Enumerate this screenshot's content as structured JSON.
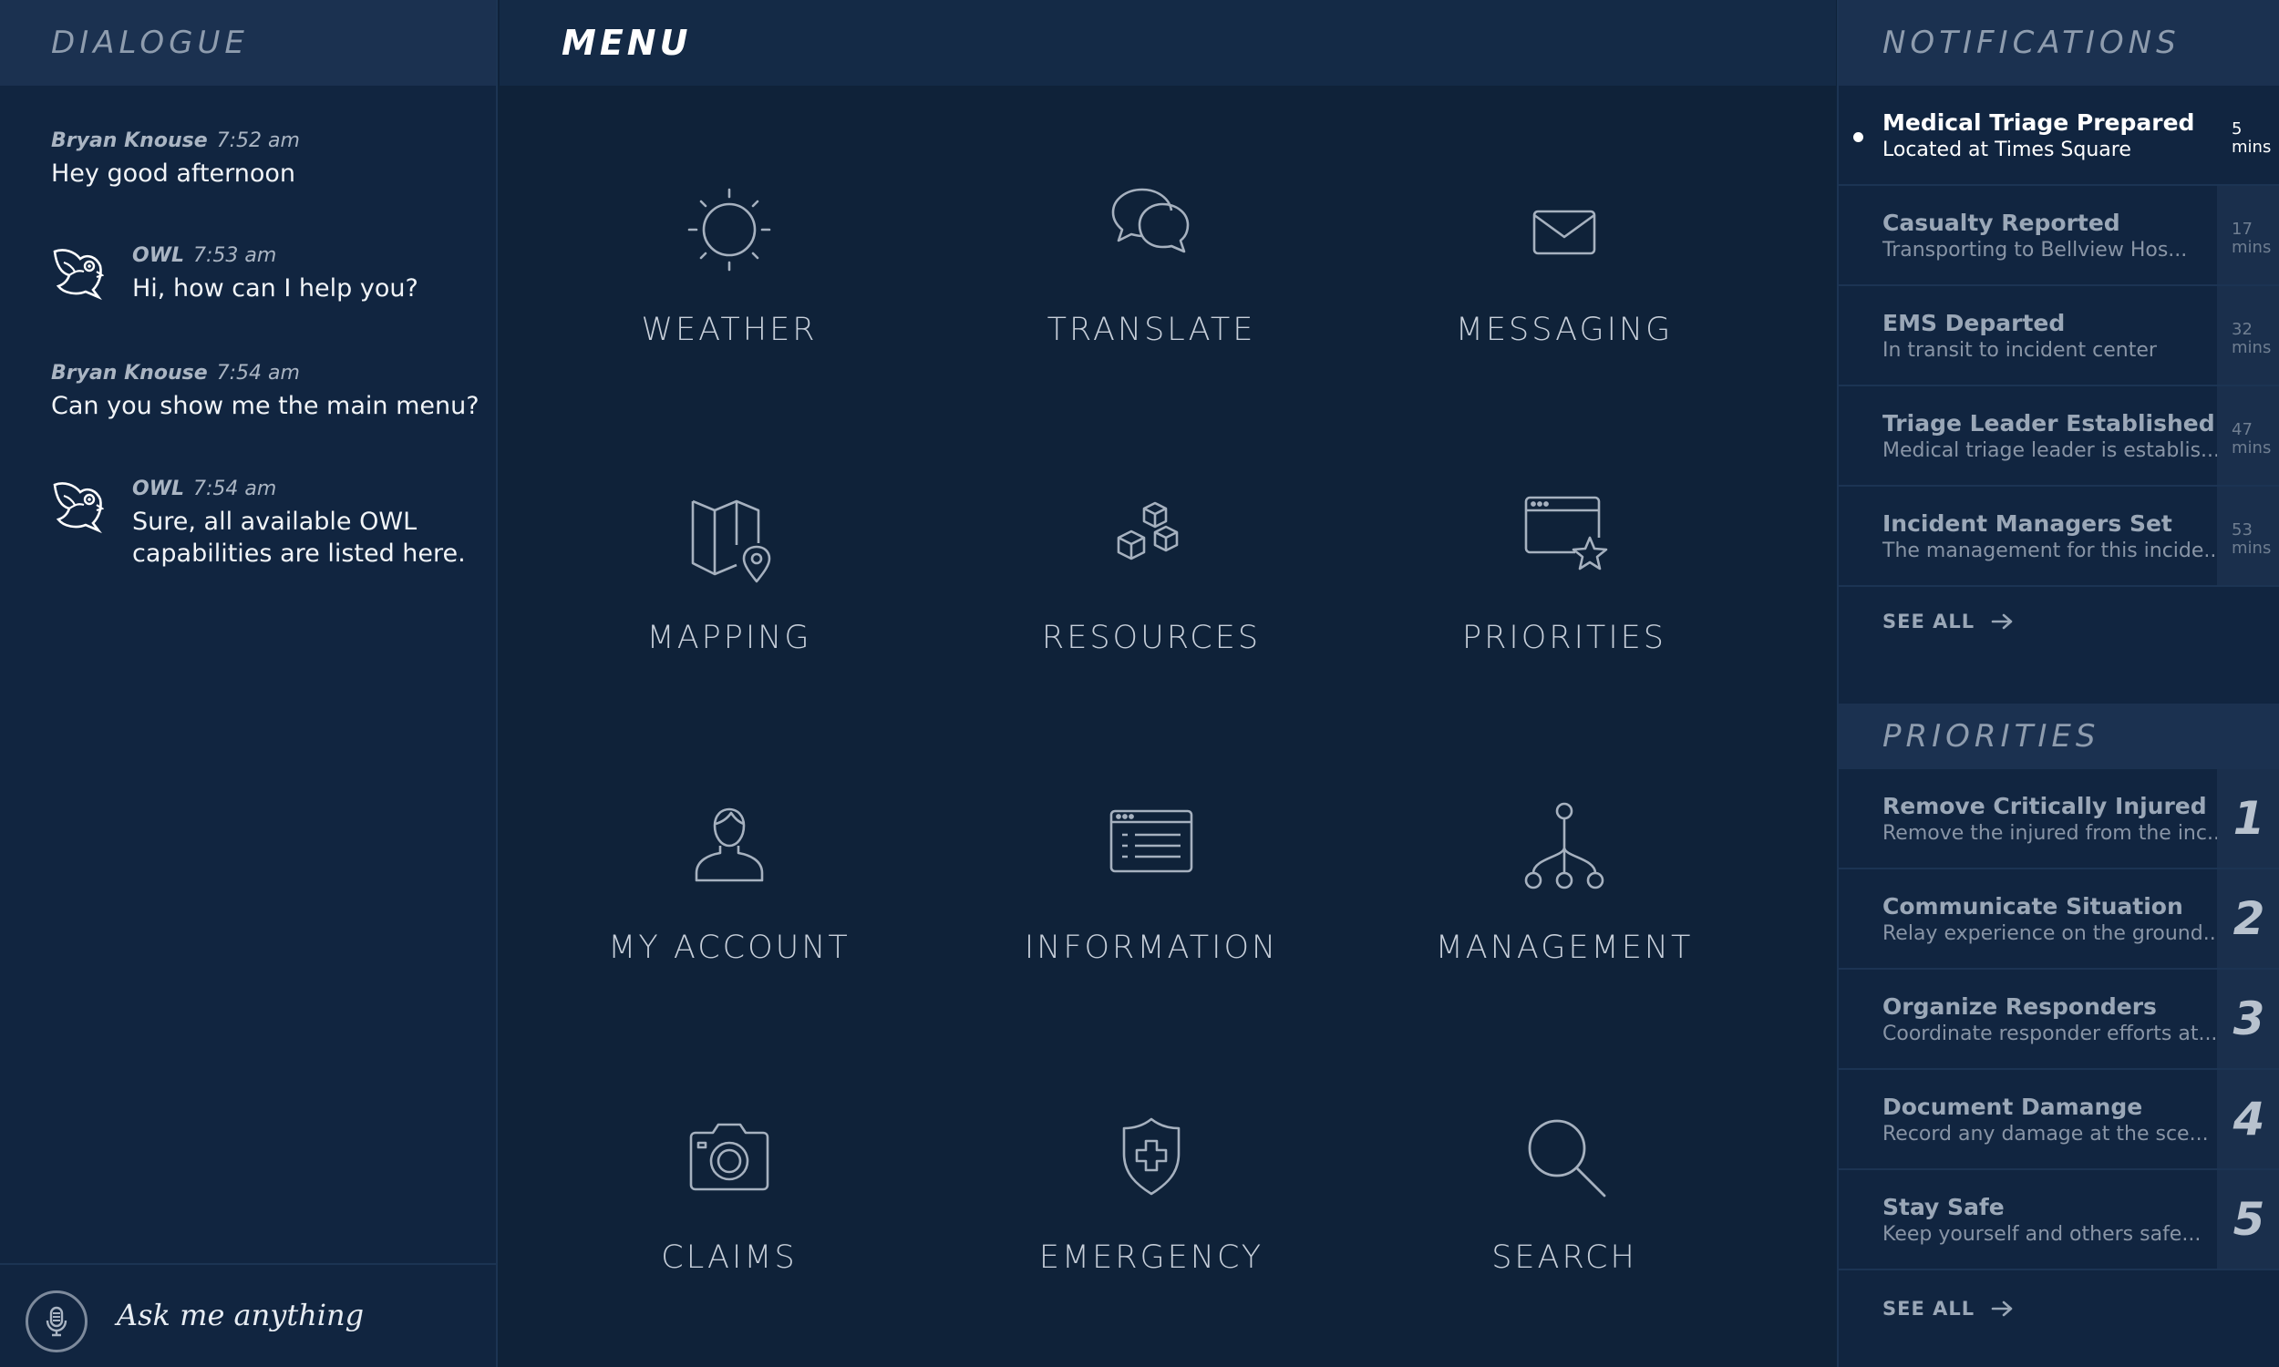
{
  "dialogue": {
    "title": "DIALOGUE",
    "messages": [
      {
        "author": "Bryan Knouse",
        "time": "7:52 am",
        "text": "Hey good afternoon"
      },
      {
        "author": "OWL",
        "time": "7:53 am",
        "text": "Hi, how can I help you?"
      },
      {
        "author": "Bryan Knouse",
        "time": "7:54 am",
        "text": "Can you show me the main menu?"
      },
      {
        "author": "OWL",
        "time": "7:54 am",
        "text": "Sure, all available OWL capabilities are listed here."
      }
    ],
    "input_placeholder": "Ask me anything"
  },
  "menu": {
    "title": "MENU",
    "items": [
      {
        "label": "WEATHER",
        "icon": "sun-icon"
      },
      {
        "label": "TRANSLATE",
        "icon": "chat-bubbles-icon"
      },
      {
        "label": "MESSAGING",
        "icon": "envelope-icon"
      },
      {
        "label": "MAPPING",
        "icon": "map-pin-icon"
      },
      {
        "label": "RESOURCES",
        "icon": "boxes-icon"
      },
      {
        "label": "PRIORITIES",
        "icon": "window-star-icon"
      },
      {
        "label": "MY ACCOUNT",
        "icon": "user-icon"
      },
      {
        "label": "INFORMATION",
        "icon": "document-window-icon"
      },
      {
        "label": "MANAGEMENT",
        "icon": "hierarchy-icon"
      },
      {
        "label": "CLAIMS",
        "icon": "camera-icon"
      },
      {
        "label": "EMERGENCY",
        "icon": "shield-cross-icon"
      },
      {
        "label": "SEARCH",
        "icon": "search-icon"
      }
    ]
  },
  "notifications": {
    "title": "NOTIFICATIONS",
    "items": [
      {
        "title": "Medical Triage Prepared",
        "subtitle": "Located at Times Square",
        "time_value": "5",
        "time_unit": "mins"
      },
      {
        "title": "Casualty Reported",
        "subtitle": "Transporting to Bellview Hos...",
        "time_value": "17",
        "time_unit": "mins"
      },
      {
        "title": "EMS Departed",
        "subtitle": "In transit to incident center",
        "time_value": "32",
        "time_unit": "mins"
      },
      {
        "title": "Triage Leader Established",
        "subtitle": "Medical triage leader is establis...",
        "time_value": "47",
        "time_unit": "mins"
      },
      {
        "title": "Incident Managers Set",
        "subtitle": "The management for this incide...",
        "time_value": "53",
        "time_unit": "mins"
      }
    ],
    "see_all": "SEE ALL"
  },
  "priorities": {
    "title": "PRIORITIES",
    "items": [
      {
        "title": "Remove Critically Injured",
        "subtitle": "Remove the injured from the inc...",
        "rank": "1"
      },
      {
        "title": "Communicate Situation",
        "subtitle": "Relay experience on the ground...",
        "rank": "2"
      },
      {
        "title": "Organize Responders",
        "subtitle": "Coordinate responder efforts at...",
        "rank": "3"
      },
      {
        "title": "Document Damange",
        "subtitle": "Record any damage at the sce...",
        "rank": "4"
      },
      {
        "title": "Stay Safe",
        "subtitle": "Keep yourself and others safe...",
        "rank": "5"
      }
    ],
    "see_all": "SEE ALL"
  },
  "colors": {
    "background": "#0f2239",
    "panel": "#112540",
    "header": "#1b3150",
    "icon_stroke": "#a6b1bf"
  }
}
